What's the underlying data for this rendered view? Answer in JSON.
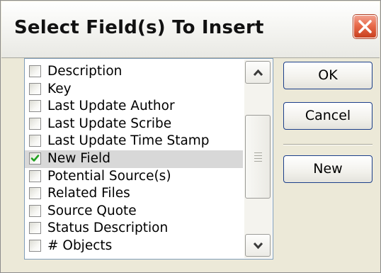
{
  "dialog": {
    "title": "Select Field(s) To Insert",
    "close_icon": "close-icon"
  },
  "fields": {
    "items": [
      {
        "label": "Description",
        "checked": false
      },
      {
        "label": "Key",
        "checked": false
      },
      {
        "label": "Last Update Author",
        "checked": false
      },
      {
        "label": "Last Update Scribe",
        "checked": false
      },
      {
        "label": "Last Update Time Stamp",
        "checked": false
      },
      {
        "label": "New Field",
        "checked": true
      },
      {
        "label": "Potential Source(s)",
        "checked": false
      },
      {
        "label": "Related Files",
        "checked": false
      },
      {
        "label": "Source Quote",
        "checked": false
      },
      {
        "label": "Status Description",
        "checked": false
      },
      {
        "label": "# Objects",
        "checked": false
      }
    ]
  },
  "buttons": {
    "ok_label": "OK",
    "cancel_label": "Cancel",
    "new_label": "New"
  },
  "colors": {
    "close_button": "#e05a3a",
    "check_mark": "#21a121",
    "button_border": "#1c3f8a",
    "selected_row": "#d8d8d8"
  }
}
